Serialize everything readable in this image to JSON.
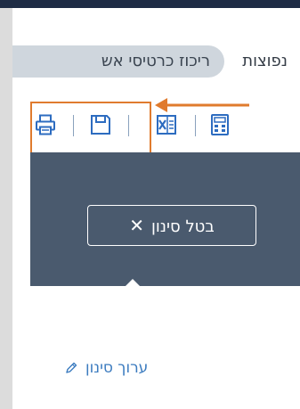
{
  "tabs": {
    "common": "נפוצות",
    "active": "ריכוז כרטיסי אש"
  },
  "toolbar": {
    "icons": [
      "printer-icon",
      "save-icon",
      "excel-icon",
      "calculator-icon"
    ]
  },
  "filter": {
    "clear_label": "בטל סינון",
    "clear_x": "✕",
    "edit_label": "ערוך סינון"
  },
  "colors": {
    "header": "#1e2c45",
    "panel": "#4a5a6e",
    "accent_blue": "#2d6cc0",
    "highlight_orange": "#e07b2e",
    "link_blue": "#3b7bbf",
    "tab_pill": "#cfd6dd"
  }
}
